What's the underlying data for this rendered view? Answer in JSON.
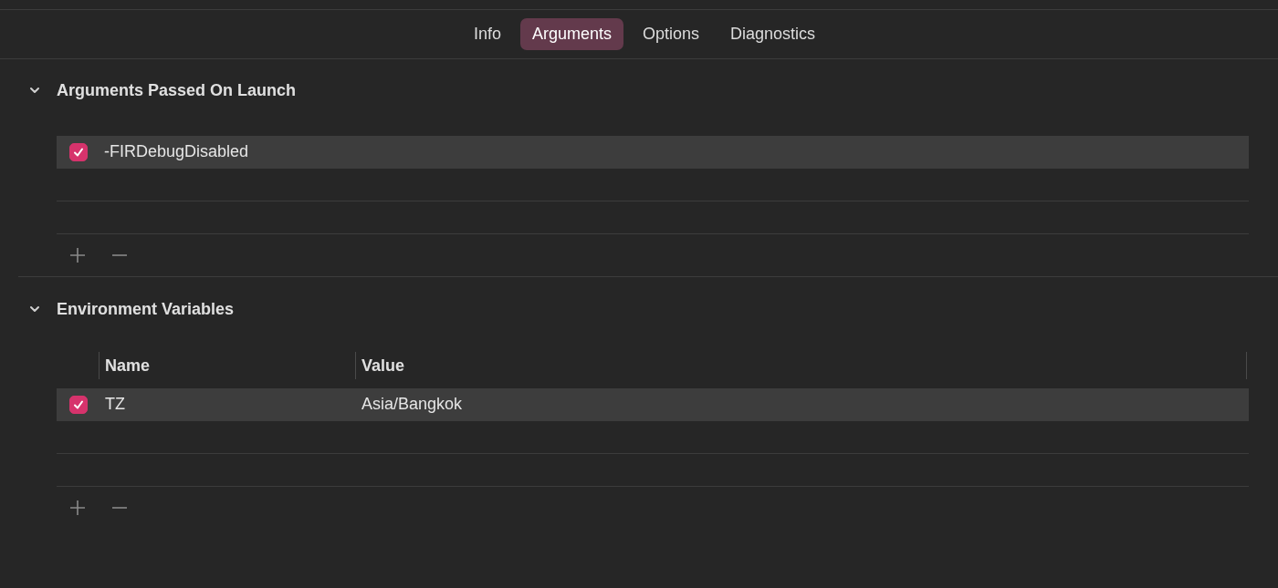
{
  "tabs": [
    {
      "label": "Info",
      "selected": false
    },
    {
      "label": "Arguments",
      "selected": true
    },
    {
      "label": "Options",
      "selected": false
    },
    {
      "label": "Diagnostics",
      "selected": false
    }
  ],
  "sections": [
    {
      "title": "Arguments Passed On Launch",
      "expanded": true,
      "kind": "list",
      "rows": [
        {
          "checked": true,
          "selected": true,
          "cells": [
            "-FIRDebugDisabled"
          ]
        }
      ]
    },
    {
      "title": "Environment Variables",
      "expanded": true,
      "kind": "table",
      "columns": [
        "Name",
        "Value"
      ],
      "rows": [
        {
          "checked": true,
          "selected": true,
          "cells": [
            "TZ",
            "Asia/Bangkok"
          ]
        }
      ]
    }
  ]
}
